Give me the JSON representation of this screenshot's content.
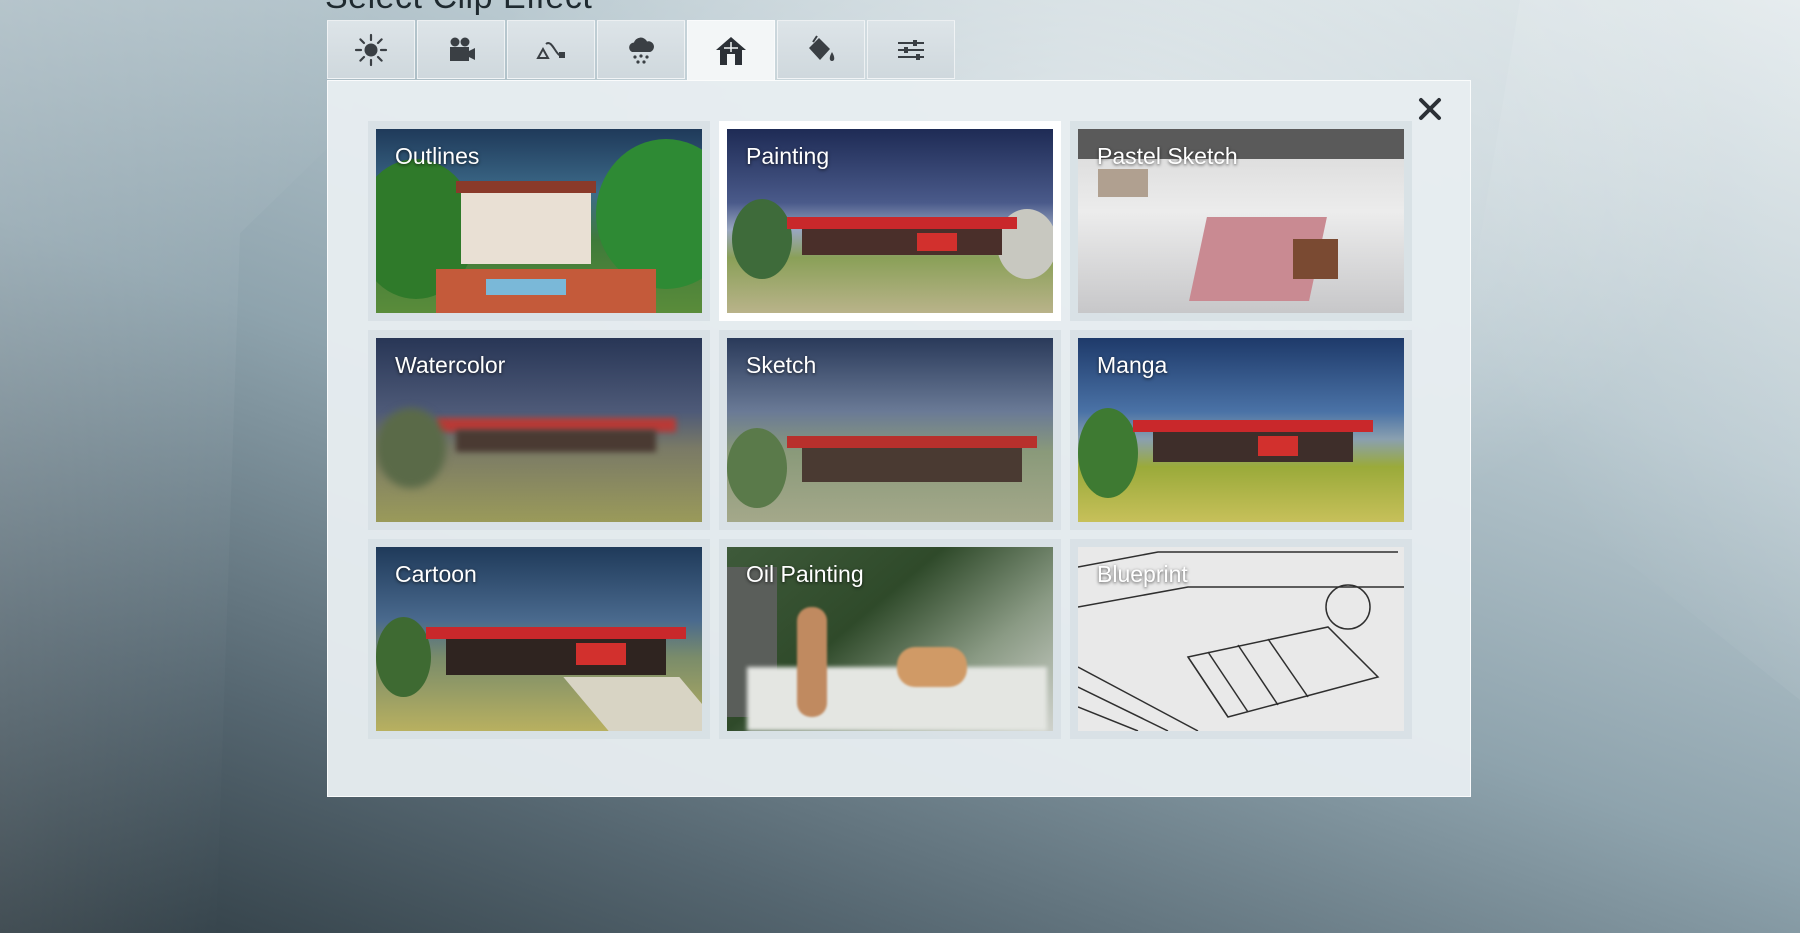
{
  "title": "Select Clip Effect",
  "tabs": [
    {
      "icon": "sun-icon",
      "active": false
    },
    {
      "icon": "video-camera-icon",
      "active": false
    },
    {
      "icon": "path-shape-icon",
      "active": false
    },
    {
      "icon": "cloud-rain-icon",
      "active": false
    },
    {
      "icon": "house-icon",
      "active": true
    },
    {
      "icon": "paint-bucket-icon",
      "active": false
    },
    {
      "icon": "sliders-icon",
      "active": false
    }
  ],
  "effects": [
    {
      "label": "Outlines"
    },
    {
      "label": "Painting",
      "selected": true
    },
    {
      "label": "Pastel Sketch"
    },
    {
      "label": "Watercolor"
    },
    {
      "label": "Sketch"
    },
    {
      "label": "Manga"
    },
    {
      "label": "Cartoon"
    },
    {
      "label": "Oil Painting"
    },
    {
      "label": "Blueprint"
    }
  ],
  "close_icon": "close-icon",
  "colors": {
    "roof_red": "#c9282b",
    "panel_bg": "#e7edf0"
  }
}
